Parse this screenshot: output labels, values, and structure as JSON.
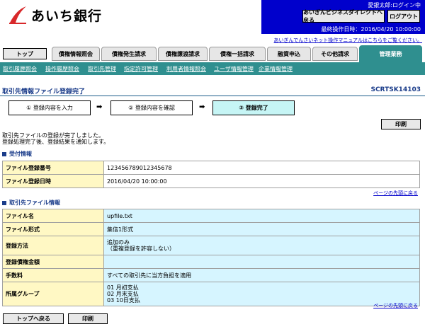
{
  "header": {
    "bank_name": "あいち銀行",
    "user_status": "愛銀太郎:ログイン中",
    "direct_button": "あいぎんビジネスダイレクトへ戻る",
    "logout_button": "ログアウト",
    "last_operation": "最終操作日時：2016/04/20 10:00:00",
    "manual_link": "あいぎんでんさいネット操作マニュアルはこちらをご覧ください。"
  },
  "tabs": {
    "top": "トップ",
    "items": [
      "債権情報照会",
      "債権発生請求",
      "債権譲渡請求",
      "債権一括請求",
      "融資申込",
      "その他請求",
      "管理業務"
    ]
  },
  "subnav": [
    "取引履歴照会",
    "操作履歴照会",
    "取引先管理",
    "指定許可管理",
    "利用者情報照会",
    "ユーザ情報管理",
    "企業情報管理"
  ],
  "title": {
    "text": "取引先情報ファイル登録完了",
    "code": "SCRTSK14103"
  },
  "steps": [
    "① 登録内容を入力",
    "② 登録内容を確認",
    "③ 登録完了"
  ],
  "arrow": "➡",
  "print_label": "印刷",
  "message": [
    "取引先ファイルの登録が完了しました。",
    "登録処理完了後、登録結果を通知します。"
  ],
  "reception": {
    "heading": "受付情報",
    "rows": [
      {
        "label": "ファイル登録番号",
        "value": "123456789012345678"
      },
      {
        "label": "ファイル登録日時",
        "value": "2016/04/20 10:00:00"
      }
    ]
  },
  "page_top_link": "ページの先頭に戻る",
  "file_info": {
    "heading": "取引先ファイル情報",
    "rows": [
      {
        "label": "ファイル名",
        "value": "upfile.txt"
      },
      {
        "label": "ファイル形式",
        "value": "集信1形式"
      },
      {
        "label": "登録方法",
        "value": "追加のみ\n（重複登録を許容しない）"
      },
      {
        "label": "登録債権金額",
        "value": ""
      },
      {
        "label": "手数料",
        "value": "すべての取引先に当方負担を適用"
      },
      {
        "label": "所属グループ",
        "value": "01 月初支払\n02 月末支払\n03 10日支払"
      }
    ]
  },
  "footer": {
    "back_top": "トップへ戻る",
    "print": "印刷"
  }
}
